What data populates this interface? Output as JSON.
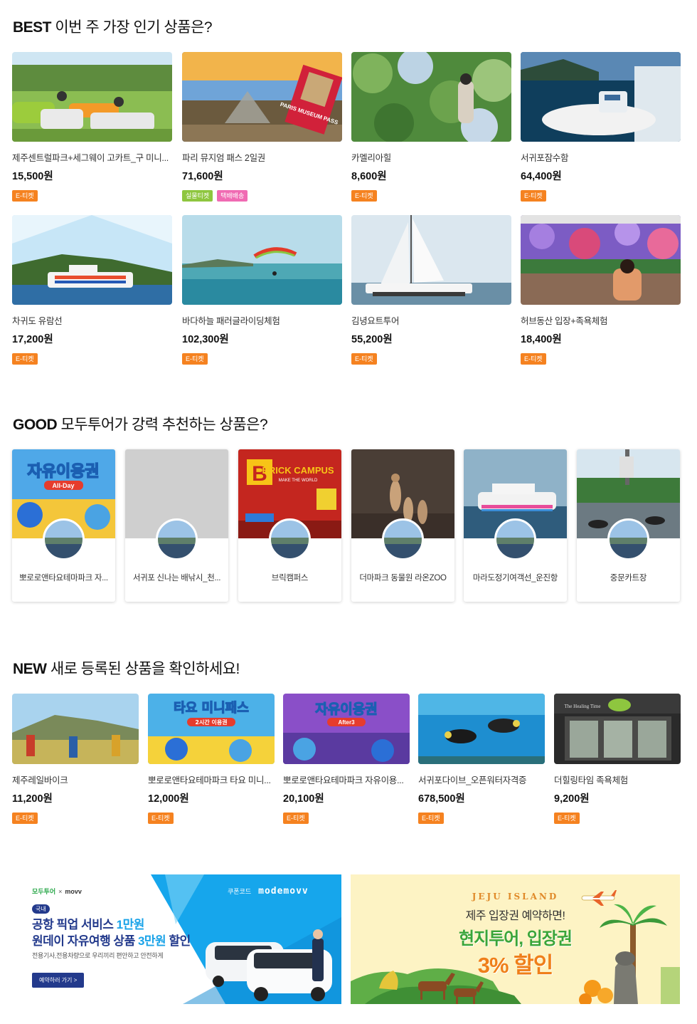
{
  "best": {
    "title_prefix": "BEST",
    "title_text": " 이번 주 가장 인기 상품은?",
    "items": [
      {
        "name": "제주센트럴파크+세그웨이 고카트_구 미니...",
        "price": "15,500원",
        "badges": [
          "E-티켓"
        ]
      },
      {
        "name": "파리 뮤지엄 패스 2일권",
        "price": "71,600원",
        "badges": [
          "실물티켓",
          "택배배송"
        ]
      },
      {
        "name": "카멜리아힐",
        "price": "8,600원",
        "badges": [
          "E-티켓"
        ]
      },
      {
        "name": "서귀포잠수함",
        "price": "64,400원",
        "badges": [
          "E-티켓"
        ]
      },
      {
        "name": "차귀도 유람선",
        "price": "17,200원",
        "badges": [
          "E-티켓"
        ]
      },
      {
        "name": "바다하늘 패러글라이딩체험",
        "price": "102,300원",
        "badges": [
          "E-티켓"
        ]
      },
      {
        "name": "김녕요트투어",
        "price": "55,200원",
        "badges": [
          "E-티켓"
        ]
      },
      {
        "name": "허브동산 입장+족욕체험",
        "price": "18,400원",
        "badges": [
          "E-티켓"
        ]
      }
    ],
    "thumb_texts": {
      "museum_pass": "PARIS MUSEUM PASS"
    }
  },
  "good": {
    "title_prefix": "GOOD",
    "title_text": " 모두투어가 강력 추천하는 상품은?",
    "items": [
      {
        "name": "뽀로로앤타요테마파크 자..."
      },
      {
        "name": "서귀포 신나는 배낚시_천..."
      },
      {
        "name": "브릭캠퍼스"
      },
      {
        "name": "더마파크 동물원 라온ZOO"
      },
      {
        "name": "마라도정기여객선_운진항"
      },
      {
        "name": "중문카트장"
      }
    ],
    "thumb_texts": {
      "pororo_title": "자유이용권",
      "pororo_sub": "All-Day",
      "brick_title": "BRICK CAMPUS",
      "brick_sub": "MAKE THE WORLD"
    }
  },
  "new": {
    "title_prefix": "NEW",
    "title_text": " 새로 등록된 상품을 확인하세요!",
    "items": [
      {
        "name": "제주레일바이크",
        "price": "11,200원",
        "badges": [
          "E-티켓"
        ]
      },
      {
        "name": "뽀로로앤타요테마파크 타요 미니...",
        "price": "12,000원",
        "badges": [
          "E-티켓"
        ]
      },
      {
        "name": "뽀로로앤타요테마파크 자유이용...",
        "price": "20,100원",
        "badges": [
          "E-티켓"
        ]
      },
      {
        "name": "서귀포다이브_오픈워터자격증",
        "price": "678,500원",
        "badges": [
          "E-티켓"
        ]
      },
      {
        "name": "더힐링타임 족욕체험",
        "price": "9,200원",
        "badges": [
          "E-티켓"
        ]
      }
    ],
    "thumb_texts": {
      "tayo_title": "타요 미니패스",
      "tayo_sub": "2시간 이용권",
      "pororo_title": "자유이용권",
      "pororo_sub": "After3",
      "healing_sign": "The Healing Time"
    }
  },
  "banner_left": {
    "brand_left": "모두투어",
    "brand_x": "×",
    "brand_right": "movv",
    "coupon_label": "쿠폰코드",
    "coupon_code": "modemovv",
    "tag": "국내",
    "line1_a": "공항 픽업 서비스 ",
    "line1_b": "1만원",
    "line2_a": "원데이 자유여행 상품 ",
    "line2_b": "3만원",
    "line2_c": " 할인",
    "sub": "전용기사,전용차량으로 우리끼리 편안하고 안전하게",
    "cta": "예약하러 가기  >"
  },
  "banner_right": {
    "kicker": "JEJU ISLAND",
    "line1": "제주 입장권 예약하면!",
    "line2": "현지투어, 입장권",
    "line3": "3% 할인"
  },
  "colors": {
    "eticket": "#f58220",
    "real_ticket": "#8ec63f",
    "delivery": "#f06bb3",
    "banner_right_bg": "#fdf3c4",
    "banner_left_accent": "#1aa3e8",
    "banner_left_navy": "#233a8c"
  }
}
